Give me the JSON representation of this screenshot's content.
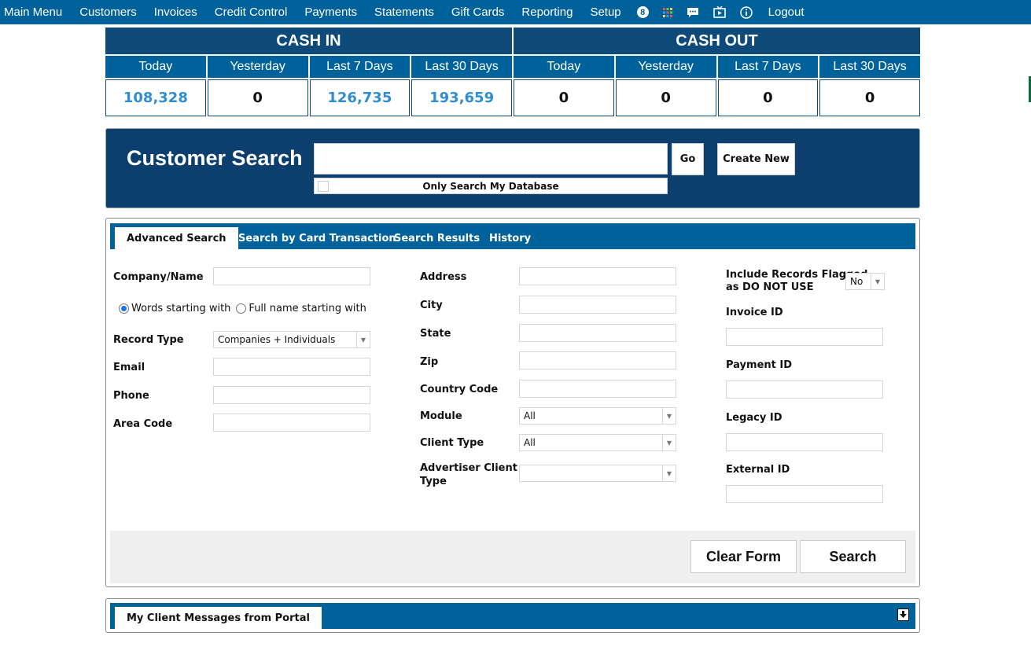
{
  "nav": {
    "items": [
      "Main Menu",
      "Customers",
      "Invoices",
      "Credit Control",
      "Payments",
      "Statements",
      "Gift Cards",
      "Reporting",
      "Setup"
    ],
    "badge_count": "8",
    "icons": [
      "grid-icon",
      "chat-icon",
      "tv-icon",
      "info-icon"
    ],
    "logout": "Logout"
  },
  "cash": {
    "cash_in_title": "CASH IN",
    "cash_out_title": "CASH OUT",
    "periods": [
      "Today",
      "Yesterday",
      "Last 7 Days",
      "Last 30 Days",
      "Today",
      "Yesterday",
      "Last 7 Days",
      "Last 30 Days"
    ],
    "values": [
      "108,328",
      "0",
      "126,735",
      "193,659",
      "0",
      "0",
      "0",
      "0"
    ]
  },
  "customer_search": {
    "title": "Customer Search",
    "input_value": "",
    "go_label": "Go",
    "create_label": "Create New",
    "only_db_label": "Only Search My Database"
  },
  "advanced": {
    "tabs": [
      "Advanced Search",
      "Search by Card Transaction",
      "Search Results",
      "History"
    ],
    "left": {
      "company_label": "Company/Name",
      "radio_words": "Words starting with",
      "radio_full": "Full name starting with",
      "record_type_label": "Record Type",
      "record_type_value": "Companies + Individuals",
      "email_label": "Email",
      "phone_label": "Phone",
      "area_label": "Area Code"
    },
    "middle": {
      "address_label": "Address",
      "city_label": "City",
      "state_label": "State",
      "zip_label": "Zip",
      "country_label": "Country Code",
      "module_label": "Module",
      "module_value": "All",
      "client_type_label": "Client Type",
      "client_type_value": "All",
      "adv_client_label_1": "Advertiser Client",
      "adv_client_label_2": "Type",
      "adv_client_value": ""
    },
    "right": {
      "flagged_label_1": "Include Records Flagged",
      "flagged_label_2": "as DO NOT USE",
      "flagged_value": "No",
      "invoice_label": "Invoice ID",
      "payment_label": "Payment ID",
      "legacy_label": "Legacy ID",
      "external_label": "External ID"
    },
    "clear_label": "Clear Form",
    "search_label": "Search"
  },
  "messages": {
    "tab_label": "My Client Messages from Portal"
  },
  "colors": {
    "nav": "#00629b",
    "dark": "#0d3f6e",
    "accent_value": "#2f8ed0"
  }
}
